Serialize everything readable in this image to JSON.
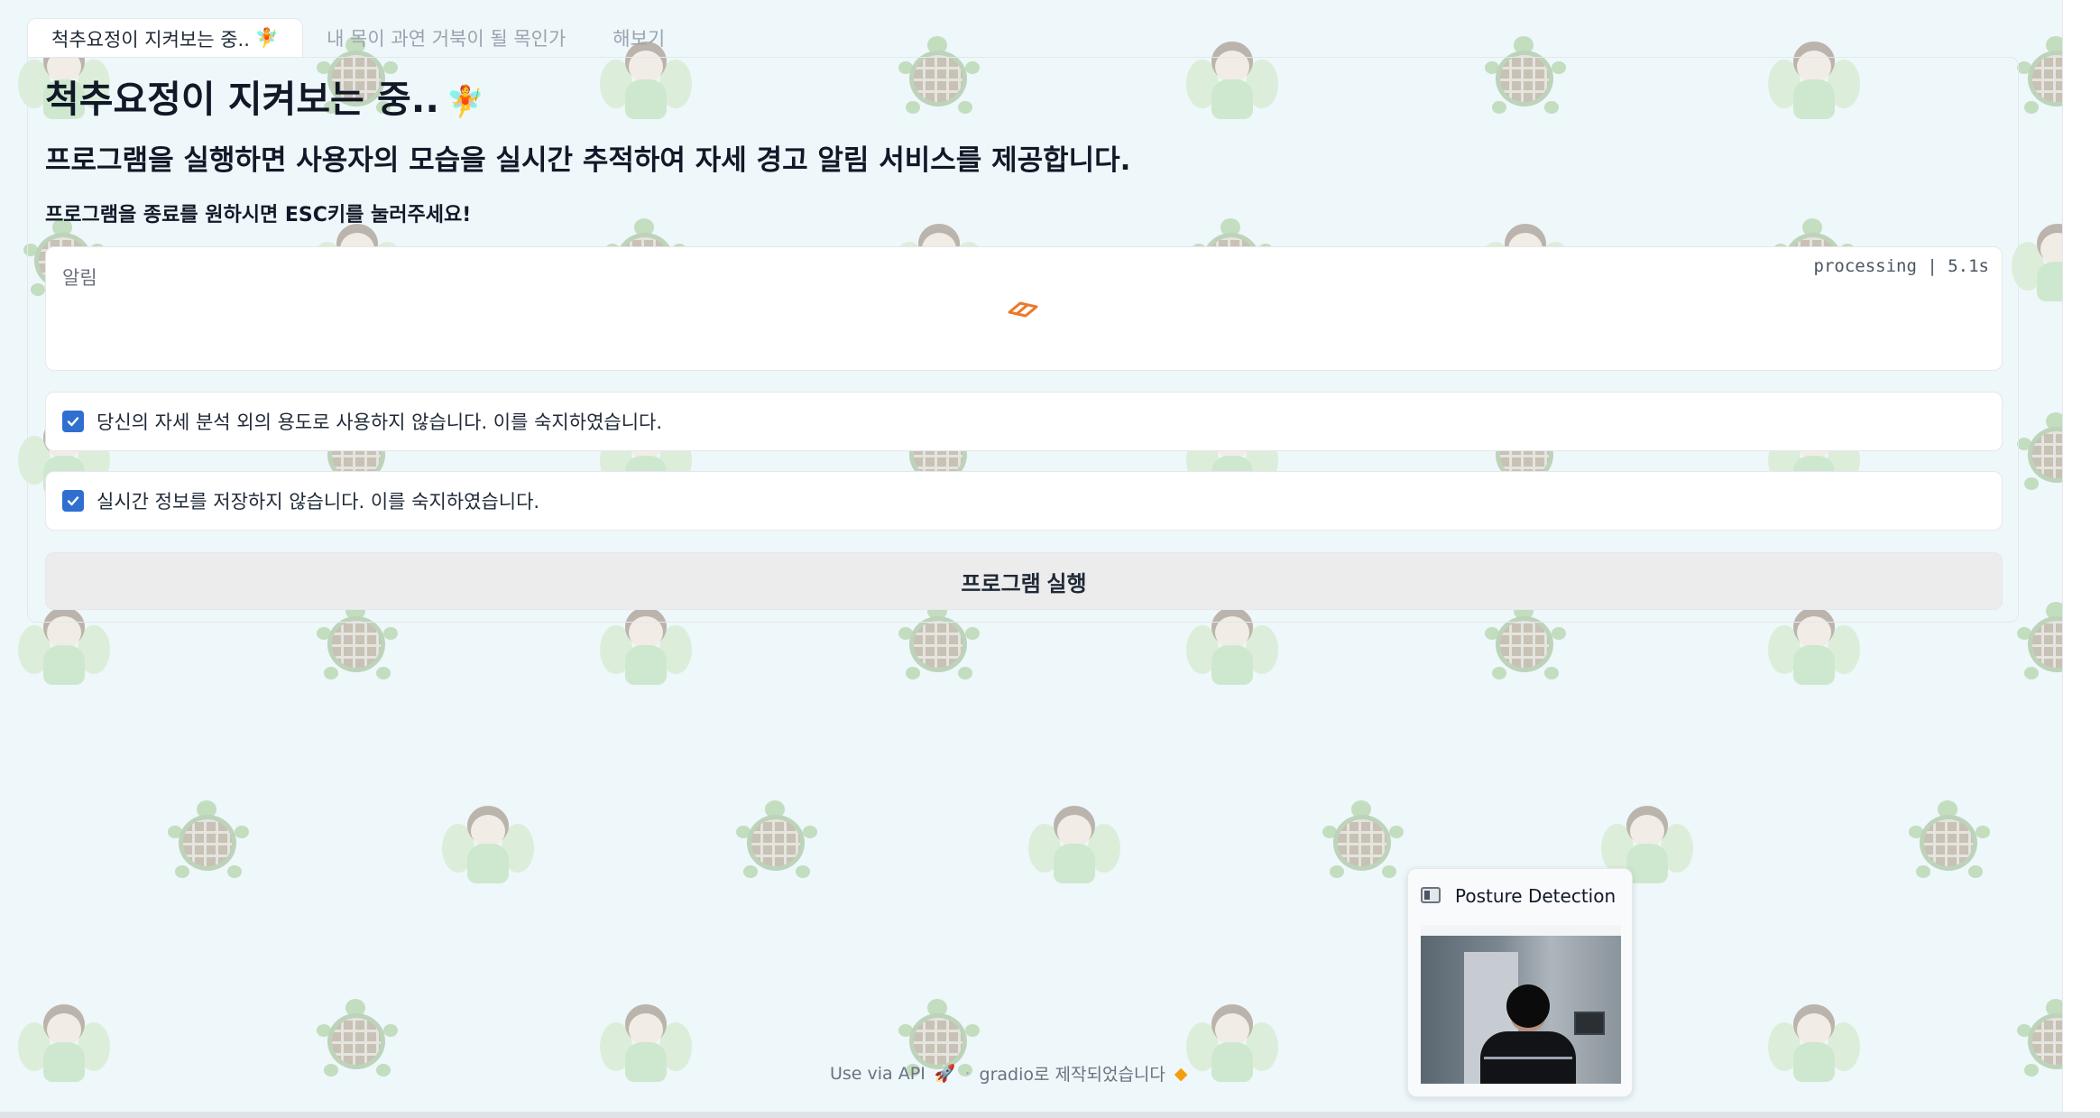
{
  "tabs": [
    {
      "label": "척추요정이 지켜보는 중..",
      "emoji": "🧚",
      "active": true
    },
    {
      "label": "내 목이 과연 거북이 될 목인가",
      "active": false
    },
    {
      "label": "해보기",
      "active": false
    }
  ],
  "main": {
    "title": "척추요정이 지켜보는 중..",
    "title_emoji": "🧚",
    "subtitle": "프로그램을 실행하면 사용자의 모습을 실시간 추적하여 자세 경고 알림 서비스를 제공합니다.",
    "esc_note": "프로그램을 종료를 원하시면 ESC키를 눌러주세요!",
    "alert": {
      "label": "알림",
      "status": "processing | 5.1s"
    },
    "checkboxes": [
      {
        "label": "당신의 자세 분석 외의 용도로 사용하지 않습니다. 이를 숙지하였습니다.",
        "checked": true
      },
      {
        "label": "실시간 정보를 저장하지 않습니다. 이를 숙지하였습니다.",
        "checked": true
      }
    ],
    "run_button": "프로그램 실행"
  },
  "footer": {
    "api_label": "Use via API",
    "separator": "·",
    "built_with": "gradio로 제작되었습니다"
  },
  "posture_window": {
    "title": "Posture Detection"
  },
  "colors": {
    "background": "#eef7fa",
    "checkbox": "#2f6fd0",
    "spinner": "#ea7a2a",
    "button_bg": "#ececec"
  }
}
